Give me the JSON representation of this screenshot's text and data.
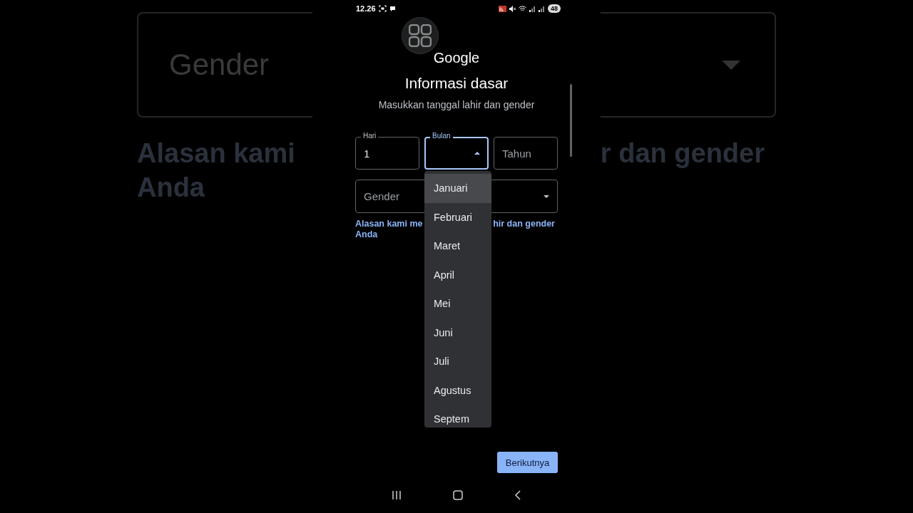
{
  "backdrop": {
    "field_placeholder": "Gender",
    "heading_parts": [
      "Alasan kami",
      "r dan gender",
      "Anda"
    ]
  },
  "status_bar": {
    "time": "12.26",
    "battery": "48"
  },
  "brand": "Google",
  "title": "Informasi dasar",
  "subtitle": "Masukkan tanggal lahir dan gender",
  "date_fields": [
    {
      "label": "Hari",
      "value": "1",
      "focused": false
    },
    {
      "label": "Bulan",
      "focused": true,
      "expanded": true
    },
    {
      "placeholder": "Tahun",
      "focused": false
    }
  ],
  "gender_field": {
    "placeholder": "Gender",
    "expanded": false
  },
  "link_parts": [
    "Alasan kami me",
    "hir dan gender",
    "Anda"
  ],
  "month_menu": {
    "items": [
      {
        "label": "Januari",
        "selected": true
      },
      {
        "label": "Februari",
        "selected": false
      },
      {
        "label": "Maret",
        "selected": false
      },
      {
        "label": "April",
        "selected": false
      },
      {
        "label": "Mei",
        "selected": false
      },
      {
        "label": "Juni",
        "selected": false
      },
      {
        "label": "Juli",
        "selected": false
      },
      {
        "label": "Agustus",
        "selected": false
      },
      {
        "label": "Septem",
        "selected": false
      }
    ]
  },
  "next_button": "Berikutnya"
}
